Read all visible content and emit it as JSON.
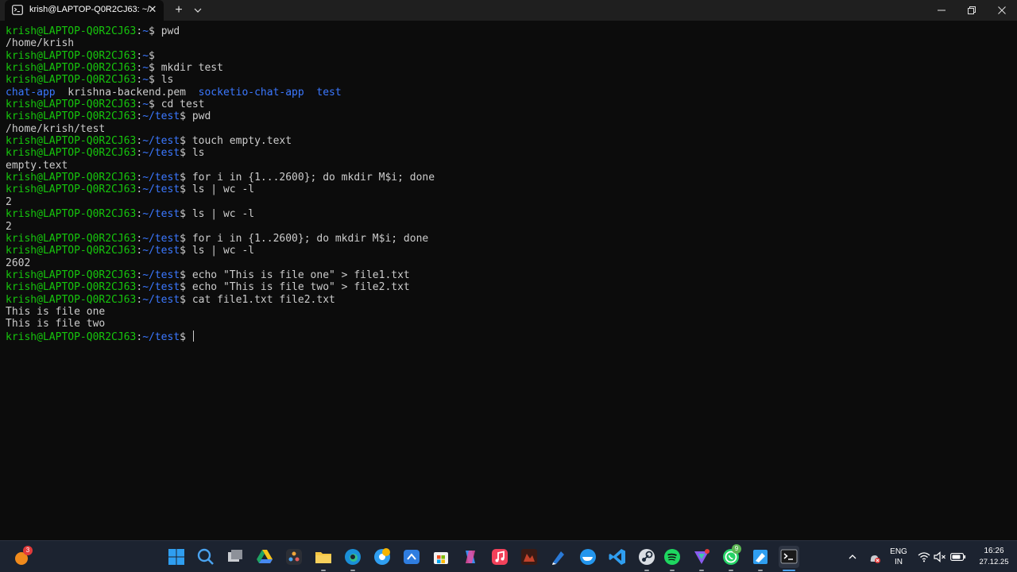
{
  "window": {
    "tab_title": "krish@LAPTOP-Q0R2CJ63: ~/",
    "new_tab": "+",
    "tab_menu": "⌄"
  },
  "colors": {
    "user": "#16c60c",
    "path": "#3b78ff",
    "dir": "#3b78ff",
    "text": "#cccccc",
    "bg": "#0c0c0c"
  },
  "terminal": {
    "lines": [
      {
        "kind": "prompt",
        "user": "krish@LAPTOP-Q0R2CJ63",
        "path": "~",
        "cmd": "pwd"
      },
      {
        "kind": "out",
        "text": "/home/krish"
      },
      {
        "kind": "prompt",
        "user": "krish@LAPTOP-Q0R2CJ63",
        "path": "~",
        "cmd": ""
      },
      {
        "kind": "prompt",
        "user": "krish@LAPTOP-Q0R2CJ63",
        "path": "~",
        "cmd": "mkdir test"
      },
      {
        "kind": "prompt",
        "user": "krish@LAPTOP-Q0R2CJ63",
        "path": "~",
        "cmd": "ls"
      },
      {
        "kind": "ls",
        "items": [
          {
            "name": "chat-app",
            "dir": true
          },
          {
            "name": "krishna-backend.pem",
            "dir": false
          },
          {
            "name": "socketio-chat-app",
            "dir": true
          },
          {
            "name": "test",
            "dir": true
          }
        ]
      },
      {
        "kind": "prompt",
        "user": "krish@LAPTOP-Q0R2CJ63",
        "path": "~",
        "cmd": "cd test"
      },
      {
        "kind": "prompt",
        "user": "krish@LAPTOP-Q0R2CJ63",
        "path": "~/test",
        "cmd": "pwd"
      },
      {
        "kind": "out",
        "text": "/home/krish/test"
      },
      {
        "kind": "prompt",
        "user": "krish@LAPTOP-Q0R2CJ63",
        "path": "~/test",
        "cmd": "touch empty.text"
      },
      {
        "kind": "prompt",
        "user": "krish@LAPTOP-Q0R2CJ63",
        "path": "~/test",
        "cmd": "ls"
      },
      {
        "kind": "out",
        "text": "empty.text"
      },
      {
        "kind": "prompt",
        "user": "krish@LAPTOP-Q0R2CJ63",
        "path": "~/test",
        "cmd": "for i in {1...2600}; do mkdir M$i; done"
      },
      {
        "kind": "prompt",
        "user": "krish@LAPTOP-Q0R2CJ63",
        "path": "~/test",
        "cmd": "ls | wc -l"
      },
      {
        "kind": "out",
        "text": "2"
      },
      {
        "kind": "prompt",
        "user": "krish@LAPTOP-Q0R2CJ63",
        "path": "~/test",
        "cmd": "ls | wc -l"
      },
      {
        "kind": "out",
        "text": "2"
      },
      {
        "kind": "prompt",
        "user": "krish@LAPTOP-Q0R2CJ63",
        "path": "~/test",
        "cmd": "for i in {1..2600}; do mkdir M$i; done"
      },
      {
        "kind": "prompt",
        "user": "krish@LAPTOP-Q0R2CJ63",
        "path": "~/test",
        "cmd": "ls | wc -l"
      },
      {
        "kind": "out",
        "text": "2602"
      },
      {
        "kind": "prompt",
        "user": "krish@LAPTOP-Q0R2CJ63",
        "path": "~/test",
        "cmd": "echo \"This is file one\" > file1.txt"
      },
      {
        "kind": "prompt",
        "user": "krish@LAPTOP-Q0R2CJ63",
        "path": "~/test",
        "cmd": "echo \"This is file two\" > file2.txt"
      },
      {
        "kind": "prompt",
        "user": "krish@LAPTOP-Q0R2CJ63",
        "path": "~/test",
        "cmd": "cat file1.txt file2.txt"
      },
      {
        "kind": "out",
        "text": "This is file one"
      },
      {
        "kind": "out",
        "text": "This is file two"
      },
      {
        "kind": "prompt",
        "user": "krish@LAPTOP-Q0R2CJ63",
        "path": "~/test",
        "cmd": "",
        "cursor": true
      }
    ]
  },
  "taskbar": {
    "notification_badge": "3",
    "whatsapp_badge": "9",
    "apps": [
      "start-icon",
      "search-icon",
      "task-view-icon",
      "google-drive-icon",
      "davinci-resolve-icon",
      "file-explorer-icon",
      "edge-icon",
      "chrome-canary-icon",
      "power-automate-icon",
      "microsoft-store-icon",
      "copilot-icon",
      "apple-music-icon",
      "game-icon",
      "pen-tool-icon",
      "docker-icon",
      "vscode-icon",
      "steam-icon",
      "spotify-icon",
      "proton-vpn-icon",
      "whatsapp-icon",
      "azure-data-studio-icon",
      "terminal-icon"
    ]
  },
  "tray": {
    "lang_top": "ENG",
    "lang_bottom": "IN",
    "time": "16:26",
    "date": "27.12.25"
  }
}
